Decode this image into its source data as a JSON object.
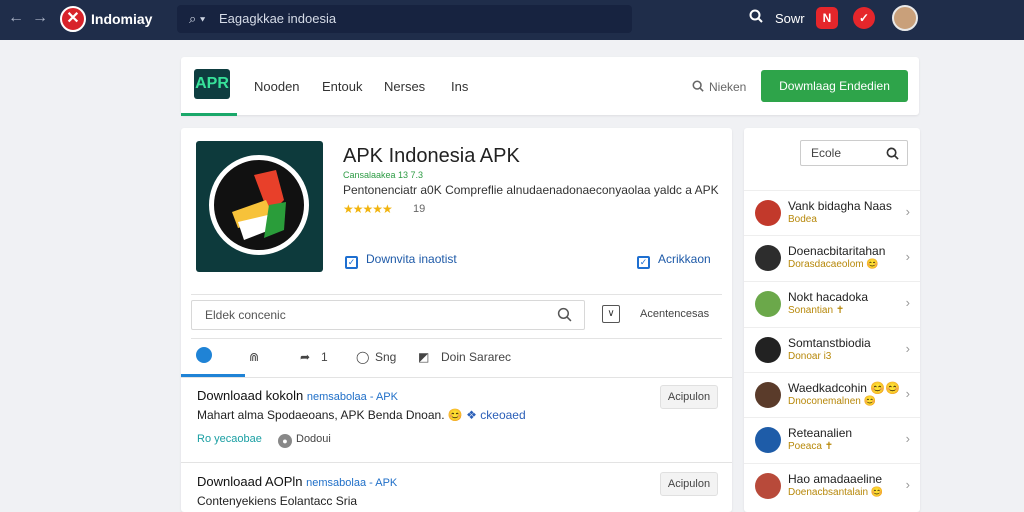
{
  "topbar": {
    "back": "←",
    "forward": "→",
    "brand_logo": "✕",
    "brand_name": "Indomiay",
    "address_icon": "⌕ ▾",
    "address_text": "Eagagkkae indoesia",
    "search_icon": "🔍",
    "search_label": "Sowr",
    "badge1": "N",
    "badge2": "✓"
  },
  "site_header": {
    "logo": "APR",
    "nav": [
      "Nooden",
      "Entouk",
      "Nerses",
      "Ins"
    ],
    "search_label": "Nieken",
    "download_label": "Dowmlaag Endedien"
  },
  "app": {
    "title": "APK Indonesia APK",
    "developer": "Cansalaakea 13 7.3",
    "description": "Pentonenciatr a0K Compreflie alnudaenadonaeconyaolaa yaldc a APK",
    "stars": "★★★★★",
    "rating": "19",
    "download_button": "Downvita inaotist",
    "add_button": "Acrikkaon",
    "search_placeholder": "Eldek concenic",
    "filter_label": "Acentencesas"
  },
  "toolbar": {
    "home": "",
    "up": "⋒",
    "share_icon": "➦",
    "share_count": "1",
    "comments_icon": "◯",
    "comments_label": "Sng",
    "save_icon": "◩",
    "save_label": "Doin Sararec"
  },
  "results": [
    {
      "title": "Downloaad kokoln",
      "tag": "nemsabolaa - APK",
      "sub_a": "Mahart alma Spodaeoans,",
      "sub_b": "APK",
      "sub_c": "Benda Dnoan.",
      "sub_d": "ckeoaed",
      "meta1": "Ro yecaobae",
      "meta2": "Dodoui",
      "button": "Acipulon"
    },
    {
      "title": "Downloaad AOPln",
      "tag": "nemsabolaa - APK",
      "sub_a": "Contenyekiens Eolantacc Sria",
      "button": "Acipulon"
    }
  ],
  "sidebar": {
    "search_label": "Ecole",
    "items": [
      {
        "name": "Vank bidagha Naas",
        "sub": "Bodea",
        "avatar_color": "#c2392b"
      },
      {
        "name": "Doenacbitaritahan",
        "sub": "Dorasdacaeolom 😊",
        "avatar_color": "#2d2d2d"
      },
      {
        "name": "Nokt hacadoka",
        "sub": "Sonantian ✝",
        "avatar_color": "#6ba84a"
      },
      {
        "name": "Somtanstbiodia",
        "sub": "Donoar i3",
        "avatar_color": "#222"
      },
      {
        "name": "Waedkadcohin 😊😊",
        "sub": "Dnoconemalnen 😊",
        "avatar_color": "#5a3b2a"
      },
      {
        "name": "Reteanalien",
        "sub": "Poeaca ✝",
        "avatar_color": "#1e5ca8"
      },
      {
        "name": "Hao amadaaeline",
        "sub": "Doenacbsantalain 😊",
        "avatar_color": "#b84a3a"
      }
    ],
    "chevron": "›"
  }
}
